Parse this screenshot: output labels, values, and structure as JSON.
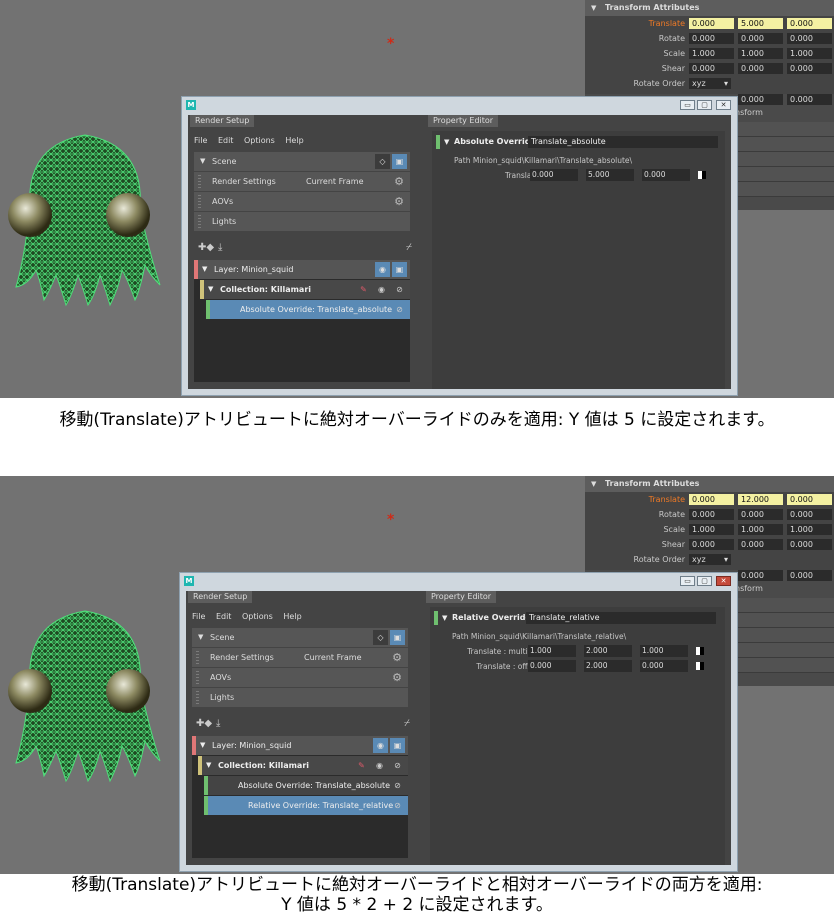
{
  "panels": [
    {
      "attr_editor": {
        "header": "Transform Attributes",
        "rows": [
          {
            "label": "Translate",
            "values": [
              "0.000",
              "5.000",
              "0.000"
            ],
            "keyed": true
          },
          {
            "label": "Rotate",
            "values": [
              "0.000",
              "0.000",
              "0.000"
            ],
            "keyed": false
          },
          {
            "label": "Scale",
            "values": [
              "1.000",
              "1.000",
              "1.000"
            ],
            "keyed": false
          },
          {
            "label": "Shear",
            "values": [
              "0.000",
              "0.000",
              "0.000"
            ],
            "keyed": false
          }
        ],
        "rotate_order_label": "Rotate Order",
        "rotate_order_value": "xyz",
        "partial_values": [
          "0.000",
          "0.000"
        ],
        "partial_text": "nsform"
      },
      "window": {
        "left_tab": "Render Setup",
        "right_tab": "Property Editor",
        "menu": [
          "File",
          "Edit",
          "Options",
          "Help"
        ],
        "scene_items": [
          {
            "label": "Scene",
            "value": ""
          },
          {
            "label": "Render Settings",
            "value": "Current Frame"
          },
          {
            "label": "AOVs",
            "value": ""
          },
          {
            "label": "Lights",
            "value": ""
          }
        ],
        "layer_label": "Layer:  Minion_squid",
        "collection_label": "Collection:  Killamari",
        "overrides": [
          {
            "label": "Absolute Override:  Translate_absolute",
            "selected": true
          }
        ],
        "prop_editor": {
          "override_type": "Absolute Override:",
          "override_name": "Translate_absolute",
          "path": "Path  Minion_squid\\Killamari\\Translate_absolute\\",
          "rows": [
            {
              "label": "Translate",
              "values": [
                "0.000",
                "5.000",
                "0.000"
              ]
            }
          ]
        }
      },
      "caption": "移動(Translate)アトリビュートに絶対オーバーライドのみを適用: Y 値は 5 に設定されます。"
    },
    {
      "attr_editor": {
        "header": "Transform Attributes",
        "rows": [
          {
            "label": "Translate",
            "values": [
              "0.000",
              "12.000",
              "0.000"
            ],
            "keyed": true
          },
          {
            "label": "Rotate",
            "values": [
              "0.000",
              "0.000",
              "0.000"
            ],
            "keyed": false
          },
          {
            "label": "Scale",
            "values": [
              "1.000",
              "1.000",
              "1.000"
            ],
            "keyed": false
          },
          {
            "label": "Shear",
            "values": [
              "0.000",
              "0.000",
              "0.000"
            ],
            "keyed": false
          }
        ],
        "rotate_order_label": "Rotate Order",
        "rotate_order_value": "xyz",
        "partial_values": [
          "0.000",
          "0.000"
        ],
        "partial_text": "nsform"
      },
      "window": {
        "left_tab": "Render Setup",
        "right_tab": "Property Editor",
        "menu": [
          "File",
          "Edit",
          "Options",
          "Help"
        ],
        "scene_items": [
          {
            "label": "Scene",
            "value": ""
          },
          {
            "label": "Render Settings",
            "value": "Current Frame"
          },
          {
            "label": "AOVs",
            "value": ""
          },
          {
            "label": "Lights",
            "value": ""
          }
        ],
        "layer_label": "Layer:  Minion_squid",
        "collection_label": "Collection:  Killamari",
        "overrides": [
          {
            "label": "Absolute Override:  Translate_absolute",
            "selected": false
          },
          {
            "label": "Relative Override:  Translate_relative",
            "selected": true
          }
        ],
        "prop_editor": {
          "override_type": "Relative Override:",
          "override_name": "Translate_relative",
          "path": "Path  Minion_squid\\Killamari\\Translate_relative\\",
          "rows": [
            {
              "label": "Translate : multiply",
              "values": [
                "1.000",
                "2.000",
                "1.000"
              ]
            },
            {
              "label": "Translate : offset",
              "values": [
                "0.000",
                "2.000",
                "0.000"
              ]
            }
          ]
        }
      },
      "caption_line1": "移動(Translate)アトリビュートに絶対オーバーライドと相対オーバーライドの両方を適用:",
      "caption_line2": "Y 値は 5 * 2 + 2 に設定されます。"
    }
  ],
  "icons": [
    "maya-logo-icon",
    "eye-icon",
    "render-icon",
    "gear-icon",
    "tree-add-icon",
    "tree-import-icon",
    "broom-icon",
    "disable-icon",
    "isolate-icon",
    "keyable-toggle-icon",
    "close-icon",
    "maximize-icon",
    "minimize-icon",
    "manipulator-icon"
  ],
  "colors": {
    "keyed_field": "#f4f1a2",
    "translate_label": "#f07a26",
    "selected_override": "#5a8ab5",
    "layer_bar": "#e07777",
    "collection_bar": "#cfc27a",
    "override_bar": "#6fbf6f",
    "mesh_green": "#4fe07a"
  }
}
